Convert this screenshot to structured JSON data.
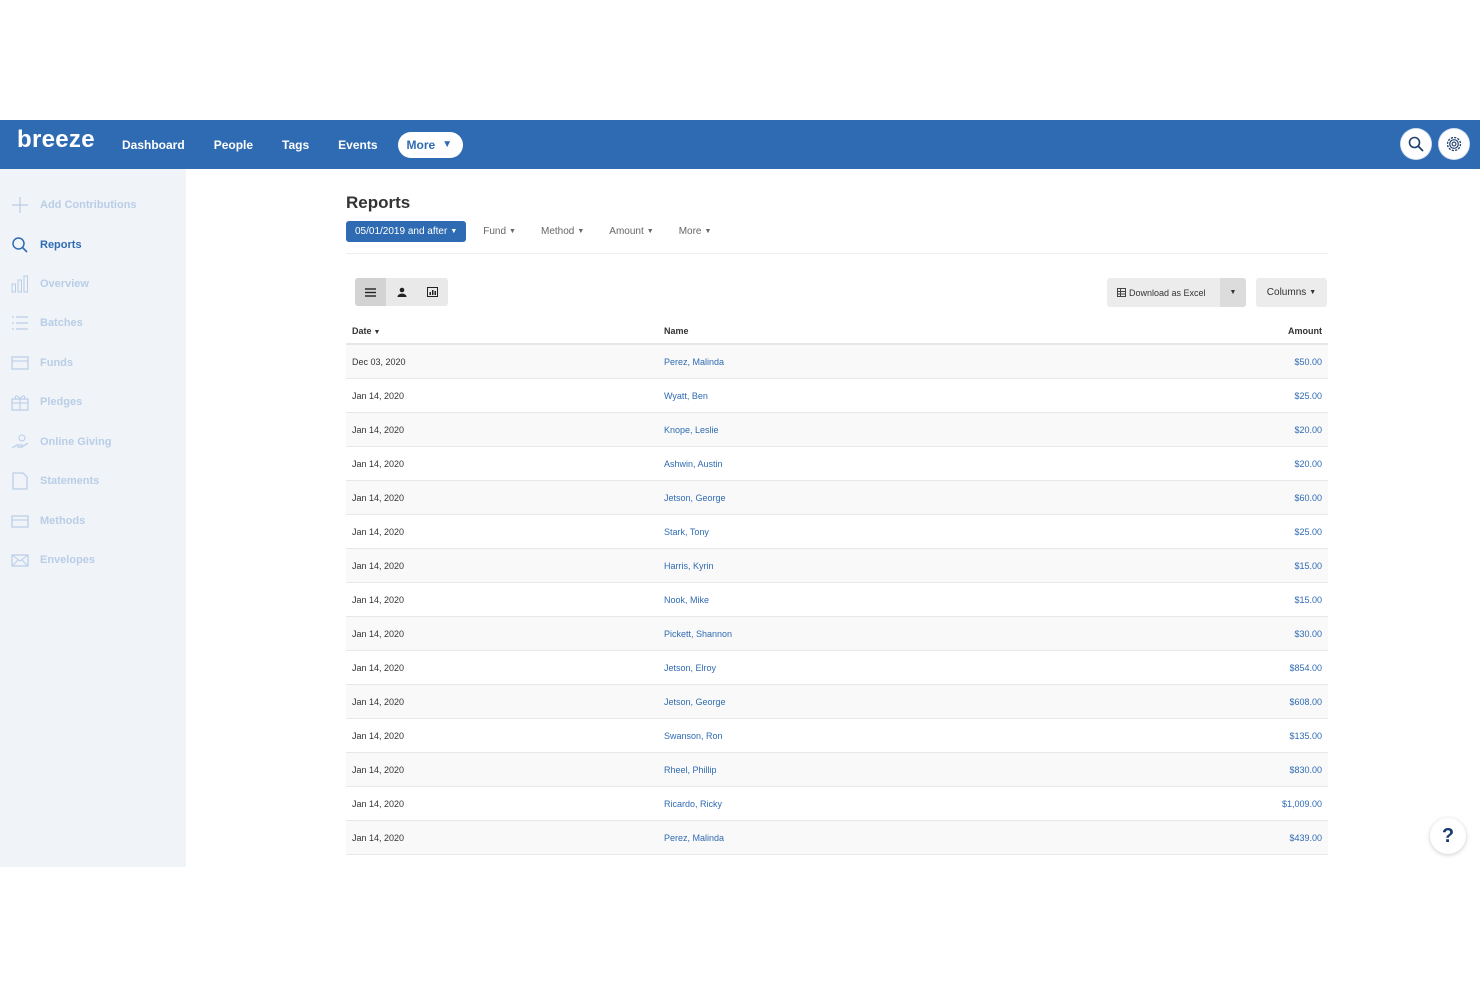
{
  "app": {
    "logo": "breeze"
  },
  "topnav": {
    "items": [
      "Dashboard",
      "People",
      "Tags",
      "Events"
    ],
    "more_label": "More"
  },
  "sidebar": {
    "items": [
      {
        "label": "Add Contributions",
        "icon": "plus-icon"
      },
      {
        "label": "Reports",
        "icon": "search-icon",
        "active": true
      },
      {
        "label": "Overview",
        "icon": "bar-chart-icon"
      },
      {
        "label": "Batches",
        "icon": "list-icon"
      },
      {
        "label": "Funds",
        "icon": "inbox-icon"
      },
      {
        "label": "Pledges",
        "icon": "gift-icon"
      },
      {
        "label": "Online Giving",
        "icon": "hand-giving-icon"
      },
      {
        "label": "Statements",
        "icon": "document-icon"
      },
      {
        "label": "Methods",
        "icon": "card-icon"
      },
      {
        "label": "Envelopes",
        "icon": "envelope-icon"
      }
    ]
  },
  "page": {
    "title": "Reports"
  },
  "filters": {
    "date": "05/01/2019 and after",
    "fund": "Fund",
    "method": "Method",
    "amount": "Amount",
    "more": "More"
  },
  "toolbar": {
    "download_label": "Download as Excel",
    "columns_label": "Columns"
  },
  "table": {
    "headers": {
      "date": "Date",
      "name": "Name",
      "amount": "Amount"
    },
    "rows": [
      {
        "date": "Dec 03, 2020",
        "name": "Perez, Malinda",
        "amount": "$50.00"
      },
      {
        "date": "Jan 14, 2020",
        "name": "Wyatt, Ben",
        "amount": "$25.00"
      },
      {
        "date": "Jan 14, 2020",
        "name": "Knope, Leslie",
        "amount": "$20.00"
      },
      {
        "date": "Jan 14, 2020",
        "name": "Ashwin, Austin",
        "amount": "$20.00"
      },
      {
        "date": "Jan 14, 2020",
        "name": "Jetson, George",
        "amount": "$60.00"
      },
      {
        "date": "Jan 14, 2020",
        "name": "Stark, Tony",
        "amount": "$25.00"
      },
      {
        "date": "Jan 14, 2020",
        "name": "Harris, Kyrin",
        "amount": "$15.00"
      },
      {
        "date": "Jan 14, 2020",
        "name": "Nook, Mike",
        "amount": "$15.00"
      },
      {
        "date": "Jan 14, 2020",
        "name": "Pickett, Shannon",
        "amount": "$30.00"
      },
      {
        "date": "Jan 14, 2020",
        "name": "Jetson, Elroy",
        "amount": "$854.00"
      },
      {
        "date": "Jan 14, 2020",
        "name": "Jetson, George",
        "amount": "$608.00"
      },
      {
        "date": "Jan 14, 2020",
        "name": "Swanson, Ron",
        "amount": "$135.00"
      },
      {
        "date": "Jan 14, 2020",
        "name": "Rheel, Phillip",
        "amount": "$830.00"
      },
      {
        "date": "Jan 14, 2020",
        "name": "Ricardo, Ricky",
        "amount": "$1,009.00"
      },
      {
        "date": "Jan 14, 2020",
        "name": "Perez, Malinda",
        "amount": "$439.00"
      }
    ]
  },
  "help": {
    "label": "?"
  },
  "colors": {
    "brand": "#2f6bb3",
    "sidebar_bg": "#f0f4f9",
    "sidebar_text": "#b9cde6"
  }
}
